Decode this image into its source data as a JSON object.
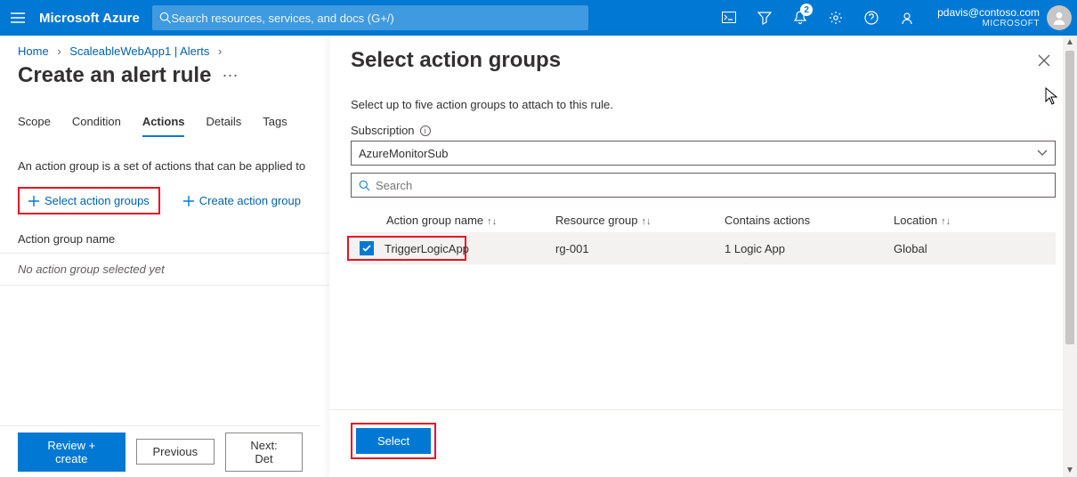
{
  "header": {
    "brand": "Microsoft Azure",
    "search_placeholder": "Search resources, services, and docs (G+/)",
    "notification_count": "2",
    "account_email": "pdavis@contoso.com",
    "account_tenant": "MICROSOFT"
  },
  "breadcrumb": {
    "items": [
      "Home",
      "ScaleableWebApp1 | Alerts"
    ]
  },
  "page": {
    "title": "Create an alert rule",
    "body_text": "An action group is a set of actions that can be applied to",
    "link_select": "Select action groups",
    "link_create": "Create action group",
    "col_header": "Action group name",
    "empty_text": "No action group selected yet"
  },
  "tabs": {
    "items": [
      {
        "label": "Scope",
        "active": false
      },
      {
        "label": "Condition",
        "active": false
      },
      {
        "label": "Actions",
        "active": true
      },
      {
        "label": "Details",
        "active": false
      },
      {
        "label": "Tags",
        "active": false
      }
    ]
  },
  "footer": {
    "review": "Review + create",
    "previous": "Previous",
    "next": "Next: Det"
  },
  "panel": {
    "title": "Select action groups",
    "desc": "Select up to five action groups to attach to this rule.",
    "sub_label": "Subscription",
    "sub_value": "AzureMonitorSub",
    "search_placeholder": "Search",
    "columns": {
      "name": "Action group name",
      "rg": "Resource group",
      "contains": "Contains actions",
      "location": "Location"
    },
    "rows": [
      {
        "name": "TriggerLogicApp",
        "rg": "rg-001",
        "contains": "1 Logic App",
        "location": "Global",
        "checked": true
      }
    ],
    "select_btn": "Select"
  }
}
